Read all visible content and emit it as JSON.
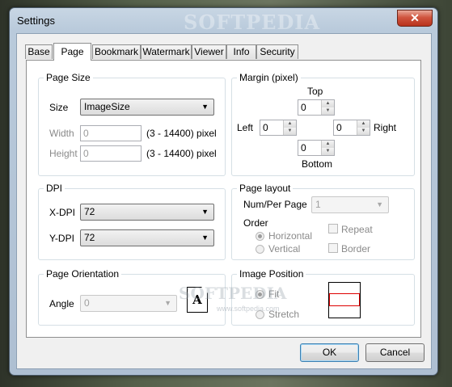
{
  "window": {
    "title": "Settings",
    "close_glyph": "✕",
    "watermark": "SOFTPEDIA"
  },
  "tabs": [
    "Base",
    "Page",
    "Bookmark",
    "Watermark",
    "Viewer",
    "Info",
    "Security"
  ],
  "active_tab": "Page",
  "page_size": {
    "title": "Page Size",
    "size_label": "Size",
    "size_value": "ImageSize",
    "width_label": "Width",
    "width_value": "0",
    "width_range": "(3 - 14400) pixel",
    "height_label": "Height",
    "height_value": "0",
    "height_range": "(3 - 14400) pixel"
  },
  "margin": {
    "title": "Margin (pixel)",
    "top_label": "Top",
    "top_value": "0",
    "left_label": "Left",
    "left_value": "0",
    "right_label": "Right",
    "right_value": "0",
    "bottom_label": "Bottom",
    "bottom_value": "0"
  },
  "dpi": {
    "title": "DPI",
    "xdpi_label": "X-DPI",
    "xdpi_value": "72",
    "ydpi_label": "Y-DPI",
    "ydpi_value": "72",
    "watermark": "SOFTPEDIA",
    "watermark_url": "www.softpedia.com"
  },
  "page_layout": {
    "title": "Page layout",
    "num_label": "Num/Per Page",
    "num_value": "1",
    "order_label": "Order",
    "horizontal_label": "Horizontal",
    "vertical_label": "Vertical",
    "repeat_label": "Repeat",
    "border_label": "Border"
  },
  "orientation": {
    "title": "Page Orientation",
    "angle_label": "Angle",
    "angle_value": "0",
    "preview_glyph": "A"
  },
  "image_position": {
    "title": "Image Position",
    "fit_label": "Fit",
    "stretch_label": "Stretch"
  },
  "buttons": {
    "ok": "OK",
    "cancel": "Cancel"
  }
}
